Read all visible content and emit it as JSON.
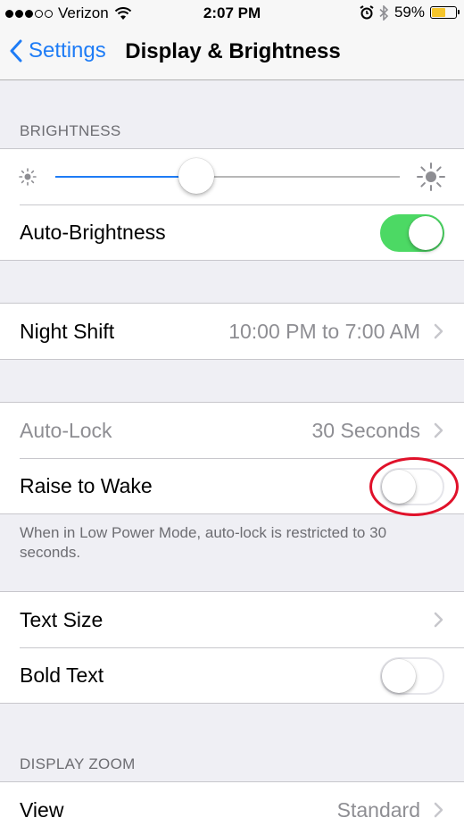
{
  "status_bar": {
    "signal_dots_full": 3,
    "signal_dots_total": 5,
    "carrier": "Verizon",
    "time": "2:07 PM",
    "battery_percent": "59%",
    "battery_level": 0.59,
    "icons": [
      "wifi-icon",
      "alarm-icon",
      "bluetooth-icon",
      "battery-icon"
    ]
  },
  "nav": {
    "back_label": "Settings",
    "title": "Display & Brightness"
  },
  "brightness": {
    "header": "BRIGHTNESS",
    "slider_value": 0.41,
    "auto_brightness_label": "Auto-Brightness",
    "auto_brightness_on": true
  },
  "night_shift": {
    "label": "Night Shift",
    "value": "10:00 PM to 7:00 AM"
  },
  "lock": {
    "auto_lock_label": "Auto-Lock",
    "auto_lock_value": "30 Seconds",
    "raise_to_wake_label": "Raise to Wake",
    "raise_to_wake_on": false,
    "note": "When in Low Power Mode, auto-lock is restricted to 30 seconds."
  },
  "text": {
    "text_size_label": "Text Size",
    "bold_text_label": "Bold Text",
    "bold_text_on": false
  },
  "zoom": {
    "header": "DISPLAY ZOOM",
    "view_label": "View",
    "view_value": "Standard"
  },
  "colors": {
    "accent": "#1e7cf6",
    "toggle_on": "#4cd964",
    "annotation": "#e0112a",
    "battery_fill": "#f5c52b"
  }
}
